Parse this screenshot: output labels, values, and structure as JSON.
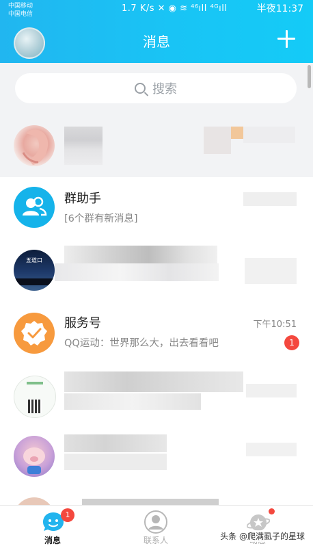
{
  "status_bar": {
    "carrier_1": "中国移动",
    "carrier_2": "中国电信",
    "speed_and_icons": "1.7 K/s  ✕  ◉  ≋  ⁴⁶ıll  ⁴ᴳıll",
    "time": "半夜11:37"
  },
  "header": {
    "title": "消息",
    "add_icon": "plus-icon"
  },
  "search": {
    "placeholder": "搜索",
    "icon": "search-icon"
  },
  "conversations": [
    {
      "kind": "pinned-contact",
      "name": "",
      "preview": "",
      "time": ""
    },
    {
      "kind": "group-helper",
      "name": "群助手",
      "preview": "[6个群有新消息]",
      "time": ""
    },
    {
      "kind": "group",
      "name": "",
      "preview": "",
      "time": "",
      "avatar_text": "五道口"
    },
    {
      "kind": "service",
      "name": "服务号",
      "preview": "QQ运动：世界那么大，出去看看吧",
      "time": "下午10:51",
      "badge": "1"
    },
    {
      "kind": "group",
      "name": "",
      "preview": "",
      "time": ""
    },
    {
      "kind": "contact",
      "name": "",
      "preview": "",
      "time": ""
    }
  ],
  "tabbar": {
    "tabs": [
      {
        "label": "消息",
        "badge": "1",
        "active": true
      },
      {
        "label": "联系人"
      },
      {
        "label": "动态"
      }
    ]
  },
  "watermark": "头条 @爬满虱子的星球",
  "colors": {
    "accent": "#21b6f0",
    "badge": "#f4483e",
    "service": "#f79a3e"
  }
}
